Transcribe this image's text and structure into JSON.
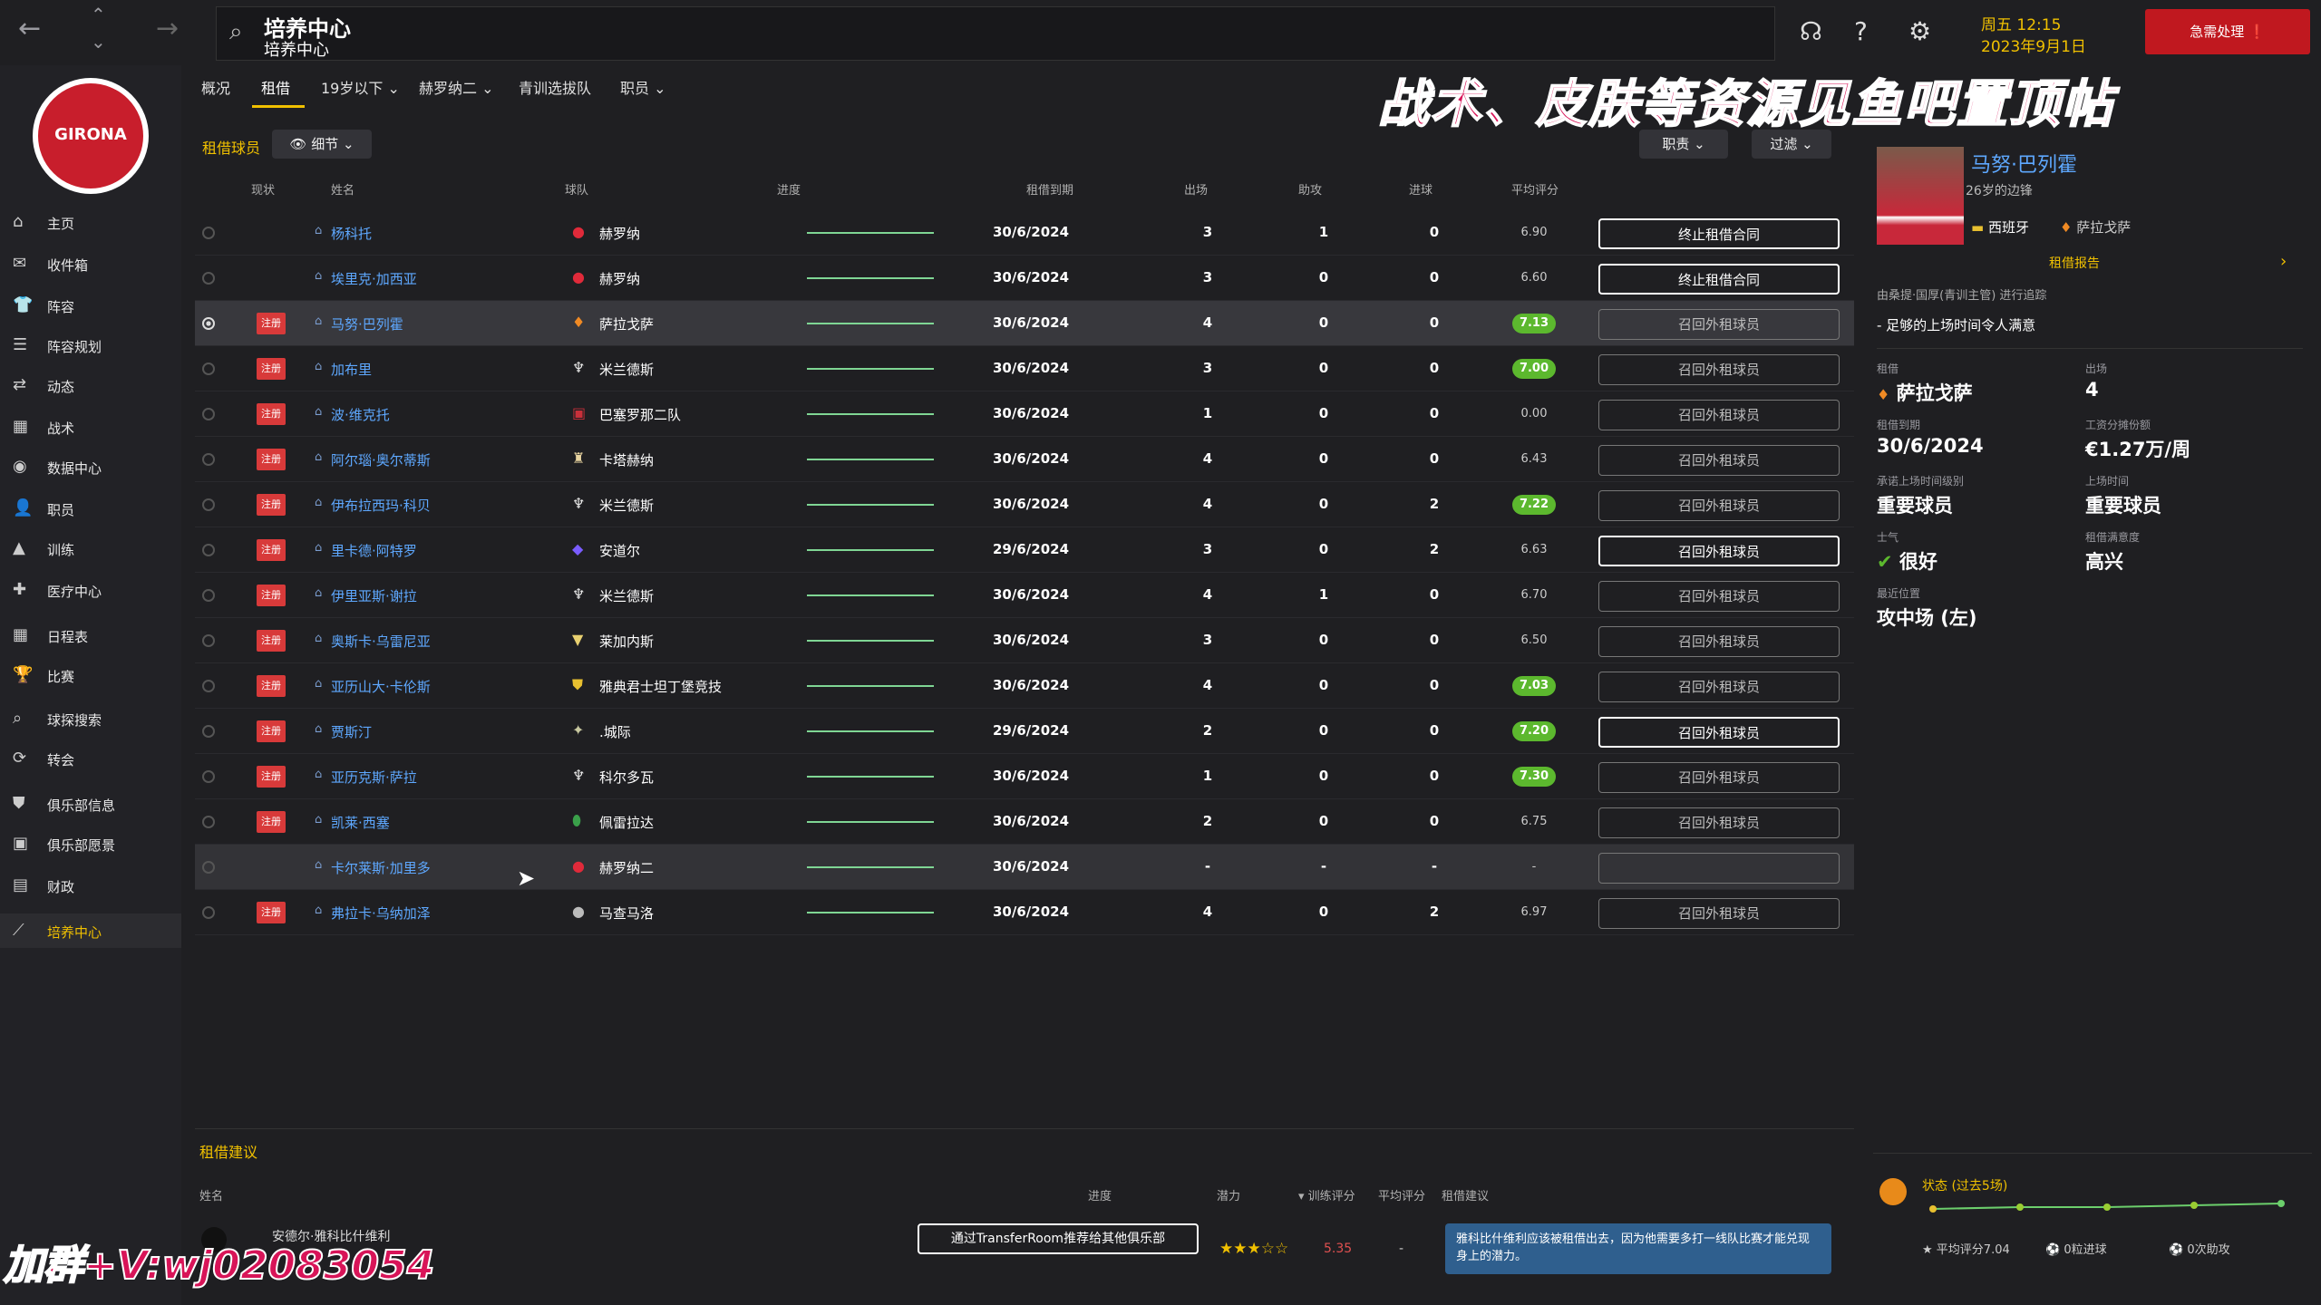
{
  "header": {
    "search_title": "培养中心",
    "search_subtitle": "培养中心",
    "datetime_line1": "周五 12:15",
    "datetime_line2": "2023年9月1日",
    "urgent_label": "急需处理"
  },
  "sidebar": {
    "logo_text": "GIRONA",
    "items": [
      {
        "icon": "home-icon",
        "glyph": "⌂",
        "label": "主页"
      },
      {
        "icon": "inbox-icon",
        "glyph": "✉",
        "label": "收件箱"
      },
      {
        "icon": "squad-icon",
        "glyph": "👕",
        "label": "阵容"
      },
      {
        "icon": "planning-icon",
        "glyph": "☰",
        "label": "阵容规划"
      },
      {
        "icon": "dynamics-icon",
        "glyph": "⇄",
        "label": "动态"
      },
      {
        "icon": "tactics-icon",
        "glyph": "▦",
        "label": "战术"
      },
      {
        "icon": "data-icon",
        "glyph": "◉",
        "label": "数据中心"
      },
      {
        "icon": "staff-icon",
        "glyph": "👤",
        "label": "职员"
      },
      {
        "icon": "training-icon",
        "glyph": "▲",
        "label": "训练"
      },
      {
        "icon": "medical-icon",
        "glyph": "✚",
        "label": "医疗中心"
      },
      {
        "icon": "schedule-icon",
        "glyph": "▦",
        "label": "日程表"
      },
      {
        "icon": "trophy-icon",
        "glyph": "🏆",
        "label": "比赛"
      },
      {
        "icon": "scouting-icon",
        "glyph": "⌕",
        "label": "球探搜索"
      },
      {
        "icon": "transfer-icon",
        "glyph": "⟳",
        "label": "转会"
      },
      {
        "icon": "club-info-icon",
        "glyph": "⛊",
        "label": "俱乐部信息"
      },
      {
        "icon": "vision-icon",
        "glyph": "▣",
        "label": "俱乐部愿景"
      },
      {
        "icon": "finance-icon",
        "glyph": "▤",
        "label": "财政"
      },
      {
        "icon": "development-icon",
        "glyph": "⟋",
        "label": "培养中心"
      }
    ]
  },
  "tabs": [
    {
      "label": "概况"
    },
    {
      "label": "租借"
    },
    {
      "label": "19岁以下 ⌄"
    },
    {
      "label": "赫罗纳二 ⌄"
    },
    {
      "label": "青训选拔队"
    },
    {
      "label": "职员 ⌄"
    }
  ],
  "banner_text": "战术、皮肤等资源见鱼吧置顶帖",
  "watermark_text": "加群+V:wj02083054",
  "loans": {
    "title": "租借球员",
    "view_label": "👁 细节 ⌄",
    "staff_filter": "职责 ⌄",
    "filter": "过滤 ⌄",
    "columns": [
      "现状",
      "姓名",
      "球队",
      "进度",
      "租借到期",
      "出场",
      "助攻",
      "进球",
      "平均评分"
    ],
    "rows": [
      {
        "badge": "",
        "name": "杨科托",
        "club_icon": "●",
        "club_color": "#e02a3a",
        "club": "赫罗纳",
        "due": "30/6/2024",
        "apps": "3",
        "ast": "1",
        "goals": "0",
        "rating": "6.90",
        "green": false,
        "action": "终止租借合同",
        "strong": true
      },
      {
        "badge": "",
        "name": "埃里克·加西亚",
        "club_icon": "●",
        "club_color": "#e02a3a",
        "club": "赫罗纳",
        "due": "30/6/2024",
        "apps": "3",
        "ast": "0",
        "goals": "0",
        "rating": "6.60",
        "green": false,
        "action": "终止租借合同",
        "strong": true
      },
      {
        "badge": "注册",
        "name": "马努·巴列霍",
        "club_icon": "♦",
        "club_color": "#f08a24",
        "club": "萨拉戈萨",
        "due": "30/6/2024",
        "apps": "4",
        "ast": "0",
        "goals": "0",
        "rating": "7.13",
        "green": true,
        "action": "召回外租球员",
        "strong": false
      },
      {
        "badge": "注册",
        "name": "加布里",
        "club_icon": "♆",
        "club_color": "#e8e8e8",
        "club": "米兰德斯",
        "due": "30/6/2024",
        "apps": "3",
        "ast": "0",
        "goals": "0",
        "rating": "7.00",
        "green": true,
        "action": "召回外租球员",
        "strong": false
      },
      {
        "badge": "注册",
        "name": "波·维克托",
        "club_icon": "▣",
        "club_color": "#c8303a",
        "club": "巴塞罗那二队",
        "due": "30/6/2024",
        "apps": "1",
        "ast": "0",
        "goals": "0",
        "rating": "0.00",
        "green": false,
        "action": "召回外租球员",
        "strong": false
      },
      {
        "badge": "注册",
        "name": "阿尔瑙·奥尔蒂斯",
        "club_icon": "♜",
        "club_color": "#e8d4a0",
        "club": "卡塔赫纳",
        "due": "30/6/2024",
        "apps": "4",
        "ast": "0",
        "goals": "0",
        "rating": "6.43",
        "green": false,
        "action": "召回外租球员",
        "strong": false
      },
      {
        "badge": "注册",
        "name": "伊布拉西玛·科贝",
        "club_icon": "♆",
        "club_color": "#e8e8e8",
        "club": "米兰德斯",
        "due": "30/6/2024",
        "apps": "4",
        "ast": "0",
        "goals": "2",
        "rating": "7.22",
        "green": true,
        "action": "召回外租球员",
        "strong": false
      },
      {
        "badge": "注册",
        "name": "里卡德·阿特罗",
        "club_icon": "◆",
        "club_color": "#7a5cff",
        "club": "安道尔",
        "due": "29/6/2024",
        "apps": "3",
        "ast": "0",
        "goals": "2",
        "rating": "6.63",
        "green": false,
        "action": "召回外租球员",
        "strong": true
      },
      {
        "badge": "注册",
        "name": "伊里亚斯·谢拉",
        "club_icon": "♆",
        "club_color": "#e8e8e8",
        "club": "米兰德斯",
        "due": "30/6/2024",
        "apps": "4",
        "ast": "1",
        "goals": "0",
        "rating": "6.70",
        "green": false,
        "action": "召回外租球员",
        "strong": false
      },
      {
        "badge": "注册",
        "name": "奥斯卡·乌雷尼亚",
        "club_icon": "▼",
        "club_color": "#e8d070",
        "club": "莱加内斯",
        "due": "30/6/2024",
        "apps": "3",
        "ast": "0",
        "goals": "0",
        "rating": "6.50",
        "green": false,
        "action": "召回外租球员",
        "strong": false
      },
      {
        "badge": "注册",
        "name": "亚历山大·卡伦斯",
        "club_icon": "⛊",
        "club_color": "#e8c030",
        "club": "雅典君士坦丁堡竞技",
        "due": "30/6/2024",
        "apps": "4",
        "ast": "0",
        "goals": "0",
        "rating": "7.03",
        "green": true,
        "action": "召回外租球员",
        "strong": false
      },
      {
        "badge": "注册",
        "name": "贾斯汀",
        "club_icon": "✦",
        "club_color": "#c8c8a0",
        "club": ".城际",
        "due": "29/6/2024",
        "apps": "2",
        "ast": "0",
        "goals": "0",
        "rating": "7.20",
        "green": true,
        "action": "召回外租球员",
        "strong": true
      },
      {
        "badge": "注册",
        "name": "亚历克斯·萨拉",
        "club_icon": "♆",
        "club_color": "#e8e8e8",
        "club": "科尔多瓦",
        "due": "30/6/2024",
        "apps": "1",
        "ast": "0",
        "goals": "0",
        "rating": "7.30",
        "green": true,
        "action": "召回外租球员",
        "strong": false
      },
      {
        "badge": "注册",
        "name": "凯莱·西塞",
        "club_icon": "⬮",
        "club_color": "#3aa04a",
        "club": "佩雷拉达",
        "due": "30/6/2024",
        "apps": "2",
        "ast": "0",
        "goals": "0",
        "rating": "6.75",
        "green": false,
        "action": "召回外租球员",
        "strong": false
      },
      {
        "badge": "",
        "name": "卡尔莱斯·加里多",
        "club_icon": "●",
        "club_color": "#e02a3a",
        "club": "赫罗纳二",
        "due": "30/6/2024",
        "apps": "-",
        "ast": "-",
        "goals": "-",
        "rating": "-",
        "green": false,
        "action": "",
        "strong": false
      },
      {
        "badge": "注册",
        "name": "弗拉卡·乌纳加泽",
        "club_icon": "●",
        "club_color": "#bbbbbb",
        "club": "马查马洛",
        "due": "30/6/2024",
        "apps": "4",
        "ast": "0",
        "goals": "2",
        "rating": "6.97",
        "green": false,
        "action": "召回外租球员",
        "strong": false
      }
    ]
  },
  "player_panel": {
    "name": "马努·巴列霍",
    "subtitle": "26岁的边锋",
    "nationality": "西班牙",
    "club": "萨拉戈萨",
    "report_link": "租借报告",
    "tracking_note": "由桑提·国厚(青训主管) 进行追踪",
    "feedback": "- 足够的上场时间令人满意",
    "loan_label": "租借",
    "loan_value": "萨拉戈萨",
    "apps_label": "出场",
    "apps_value": "4",
    "due_label": "租借到期",
    "due_value": "30/6/2024",
    "wage_label": "工资分摊份额",
    "wage_value": "€1.27万/周",
    "promised_label": "承诺上场时间级别",
    "promised_value": "重要球员",
    "playtime_label": "上场时间",
    "playtime_value": "重要球员",
    "morale_label": "士气",
    "morale_value": "很好",
    "satisfaction_label": "租借满意度",
    "satisfaction_value": "高兴",
    "position_label": "最近位置",
    "position_value": "攻中场 (左)",
    "form_title": "状态 (过去5场)",
    "form_avg": "平均评分7.04",
    "form_goals": "0粒进球",
    "form_assists": "0次助攻"
  },
  "suggestions": {
    "title": "租借建议",
    "columns": [
      "姓名",
      "进度",
      "潜力",
      "▾ 训练评分",
      "平均评分",
      "租借建议"
    ],
    "row_name": "安德尔·雅科比什维利",
    "row_button": "通过TransferRoom推荐给其他俱乐部",
    "row_stars": "★★★☆☆",
    "row_training": "5.35",
    "row_avg": "-",
    "row_advice": "雅科比什维利应该被租借出去，因为他需要多打一线队比赛才能兑现身上的潜力。"
  }
}
